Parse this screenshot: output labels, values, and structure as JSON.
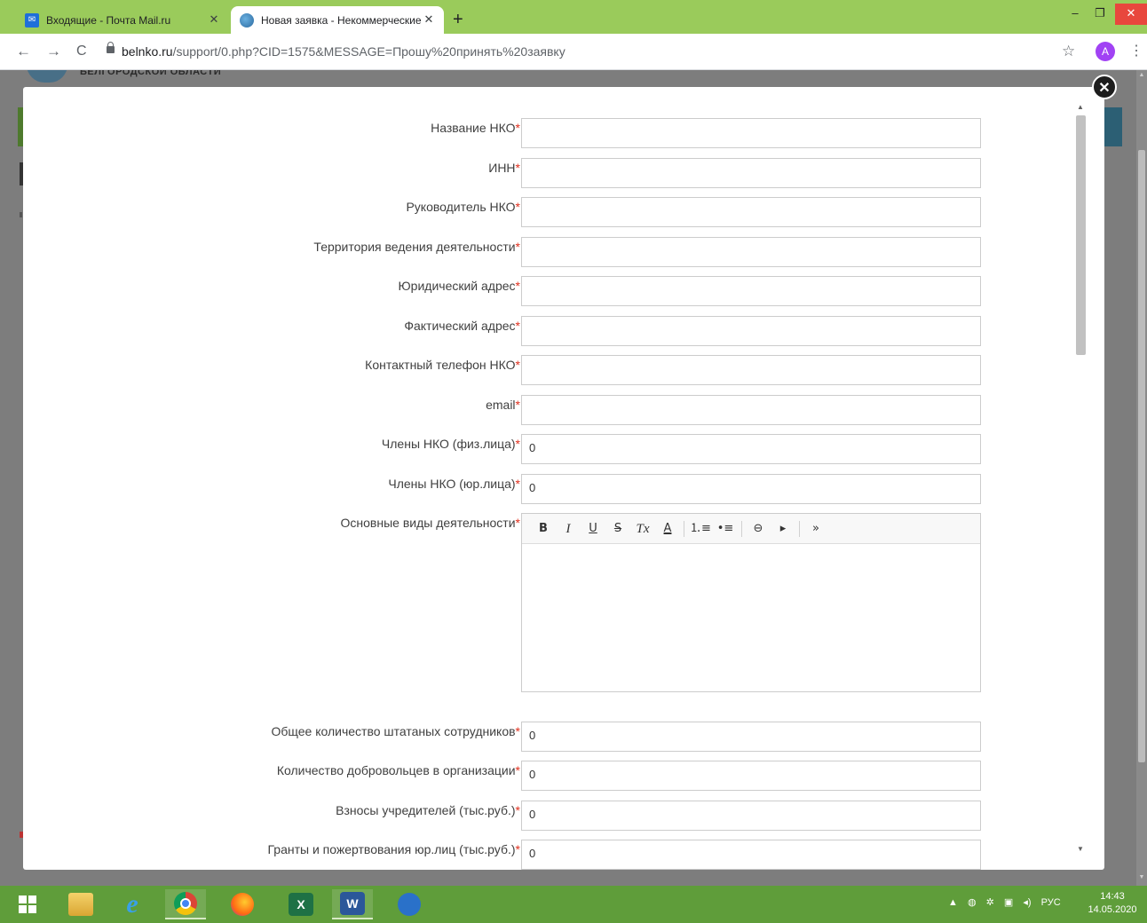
{
  "browser": {
    "tabs": [
      {
        "title": "Входящие - Почта Mail.ru",
        "active": false
      },
      {
        "title": "Новая заявка - Некоммерческие",
        "active": true
      }
    ],
    "new_tab_label": "+",
    "url_host": "belnko.ru",
    "url_rest": "/support/0.php?CID=1575&MESSAGE=Прошу%20принять%20заявку",
    "profile_initial": "A"
  },
  "background_page": {
    "logo_text": "БЕЛГОРОДСКОЙ ОБЛАСТИ"
  },
  "form": {
    "required_mark": "*",
    "fields": [
      {
        "label": "Название НКО",
        "value": ""
      },
      {
        "label": "ИНН",
        "value": ""
      },
      {
        "label": "Руководитель НКО",
        "value": ""
      },
      {
        "label": "Территория ведения деятельности",
        "value": ""
      },
      {
        "label": "Юридический адрес",
        "value": ""
      },
      {
        "label": "Фактический адрес",
        "value": ""
      },
      {
        "label": "Контактный телефон НКО",
        "value": ""
      },
      {
        "label": "email",
        "value": ""
      },
      {
        "label": "Члены НКО (физ.лица)",
        "value": "0"
      },
      {
        "label": "Члены НКО (юр.лица)",
        "value": "0"
      },
      {
        "label": "Основные виды деятельности",
        "value": ""
      },
      {
        "label": "Общее количество штатаных сотрудников",
        "value": "0"
      },
      {
        "label": "Количество добровольцев в организации",
        "value": "0"
      },
      {
        "label": "Взносы учредителей (тыс.руб.)",
        "value": "0"
      },
      {
        "label": "Гранты и пожертвования юр.лиц (тыс.руб.)",
        "value": "0"
      }
    ],
    "editor_toolbar": {
      "bold": "B",
      "italic": "I",
      "underline": "U",
      "strike": "S",
      "clear_format": "Tx",
      "text_color": "A",
      "ordered_list": "⒈≡",
      "unordered_list": "•≡",
      "link": "⊖",
      "media": "▸",
      "more": "»"
    }
  },
  "taskbar": {
    "tray_lang": "РУС",
    "time": "14:43",
    "date": "14.05.2020"
  },
  "colors": {
    "tabbar": "#9acb5b",
    "taskbar": "#5f9d3a",
    "required": "#e0301e"
  }
}
